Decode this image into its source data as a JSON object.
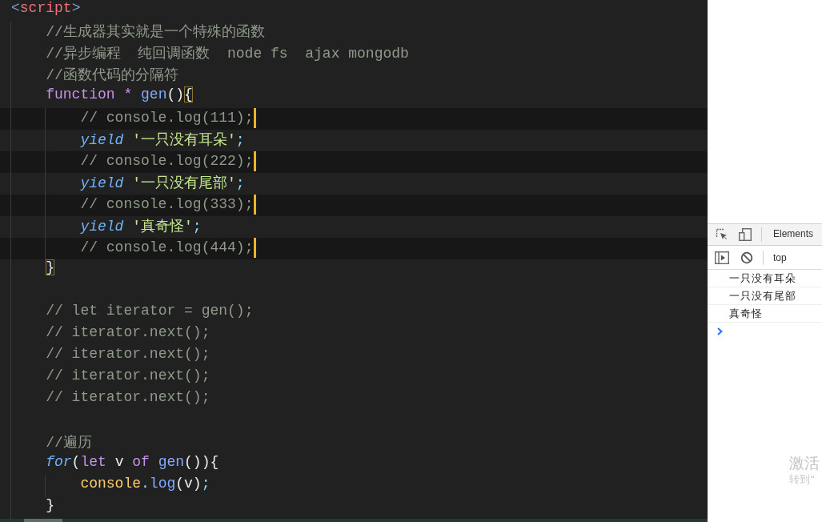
{
  "editor": {
    "lines": [
      {
        "kind": "code",
        "cursor": false,
        "tokens": [
          {
            "text": "<",
            "kind": "tag-punct"
          },
          {
            "text": "script",
            "kind": "tag"
          },
          {
            "text": ">",
            "kind": "tag-punct"
          }
        ],
        "children": [
          {
            "kind": "code",
            "cursor": false,
            "tokens": [
              {
                "text": "//生成器其实就是一个特殊的函数",
                "kind": "comment"
              }
            ]
          },
          {
            "kind": "code",
            "cursor": false,
            "tokens": [
              {
                "text": "//异步编程  纯回调函数  node fs  ajax mongodb",
                "kind": "comment"
              }
            ]
          },
          {
            "kind": "code",
            "cursor": false,
            "tokens": [
              {
                "text": "//函数代码的分隔符",
                "kind": "comment"
              }
            ]
          },
          {
            "kind": "code",
            "cursor": false,
            "tokens": [
              {
                "text": "function",
                "kind": "keyword"
              },
              {
                "text": " * ",
                "kind": "operator"
              },
              {
                "text": "gen",
                "kind": "function"
              },
              {
                "text": "()",
                "kind": "punct"
              },
              {
                "text": "{",
                "kind": "bracket-match"
              }
            ],
            "children": [
              {
                "kind": "code",
                "cursor": true,
                "tokens": [
                  {
                    "text": "// console.log(111);",
                    "kind": "comment"
                  }
                ]
              },
              {
                "kind": "code",
                "cursor": false,
                "tokens": [
                  {
                    "text": "yield",
                    "kind": "control"
                  },
                  {
                    "text": " '一只没有耳朵'",
                    "kind": "string"
                  },
                  {
                    "text": ";",
                    "kind": "accent"
                  }
                ]
              },
              {
                "kind": "code",
                "cursor": true,
                "tokens": [
                  {
                    "text": "// console.log(222);",
                    "kind": "comment"
                  }
                ]
              },
              {
                "kind": "code",
                "cursor": false,
                "tokens": [
                  {
                    "text": "yield",
                    "kind": "control"
                  },
                  {
                    "text": " '一只没有尾部'",
                    "kind": "string"
                  },
                  {
                    "text": ";",
                    "kind": "accent"
                  }
                ]
              },
              {
                "kind": "code",
                "cursor": true,
                "tokens": [
                  {
                    "text": "// console.log(333);",
                    "kind": "comment"
                  }
                ]
              },
              {
                "kind": "code",
                "cursor": false,
                "tokens": [
                  {
                    "text": "yield",
                    "kind": "control"
                  },
                  {
                    "text": " '真奇怪'",
                    "kind": "string"
                  },
                  {
                    "text": ";",
                    "kind": "accent"
                  }
                ]
              },
              {
                "kind": "code",
                "cursor": true,
                "tokens": [
                  {
                    "text": "// console.log(444);",
                    "kind": "comment"
                  }
                ]
              }
            ]
          },
          {
            "kind": "code",
            "cursor": false,
            "tokens": [
              {
                "text": "}",
                "kind": "bracket-match"
              }
            ]
          },
          {
            "kind": "blank",
            "cursor": false
          },
          {
            "kind": "code",
            "cursor": false,
            "tokens": [
              {
                "text": "// let iterator = gen();",
                "kind": "comment"
              }
            ]
          },
          {
            "kind": "code",
            "cursor": false,
            "tokens": [
              {
                "text": "// iterator.next();",
                "kind": "comment"
              }
            ]
          },
          {
            "kind": "code",
            "cursor": false,
            "tokens": [
              {
                "text": "// iterator.next();",
                "kind": "comment"
              }
            ]
          },
          {
            "kind": "code",
            "cursor": false,
            "tokens": [
              {
                "text": "// iterator.next();",
                "kind": "comment"
              }
            ]
          },
          {
            "kind": "code",
            "cursor": false,
            "tokens": [
              {
                "text": "// iterator.next();",
                "kind": "comment"
              }
            ]
          },
          {
            "kind": "blank",
            "cursor": false
          },
          {
            "kind": "code",
            "cursor": false,
            "tokens": [
              {
                "text": "//遍历",
                "kind": "comment"
              }
            ]
          },
          {
            "kind": "code",
            "cursor": false,
            "tokens": [
              {
                "text": "for",
                "kind": "control"
              },
              {
                "text": "(",
                "kind": "punct"
              },
              {
                "text": "let",
                "kind": "keyword"
              },
              {
                "text": " v ",
                "kind": "plain"
              },
              {
                "text": "of",
                "kind": "keyword"
              },
              {
                "text": " gen",
                "kind": "function"
              },
              {
                "text": "()){",
                "kind": "punct"
              }
            ],
            "children": [
              {
                "kind": "code",
                "cursor": false,
                "tokens": [
                  {
                    "text": "console",
                    "kind": "variable"
                  },
                  {
                    "text": ".",
                    "kind": "accent"
                  },
                  {
                    "text": "log",
                    "kind": "function"
                  },
                  {
                    "text": "(v)",
                    "kind": "punct"
                  },
                  {
                    "text": ";",
                    "kind": "accent"
                  }
                ]
              }
            ]
          },
          {
            "kind": "code",
            "cursor": false,
            "tokens": [
              {
                "text": "}",
                "kind": "punct"
              }
            ]
          }
        ]
      }
    ]
  },
  "devtools": {
    "tabs": [
      {
        "label": "Elements",
        "selected": false
      }
    ],
    "context": "top",
    "messages": [
      "一只没有耳朵",
      "一只没有尾部",
      "真奇怪"
    ]
  },
  "activation_notice": {
    "title": "激活",
    "hint": "转到“"
  }
}
